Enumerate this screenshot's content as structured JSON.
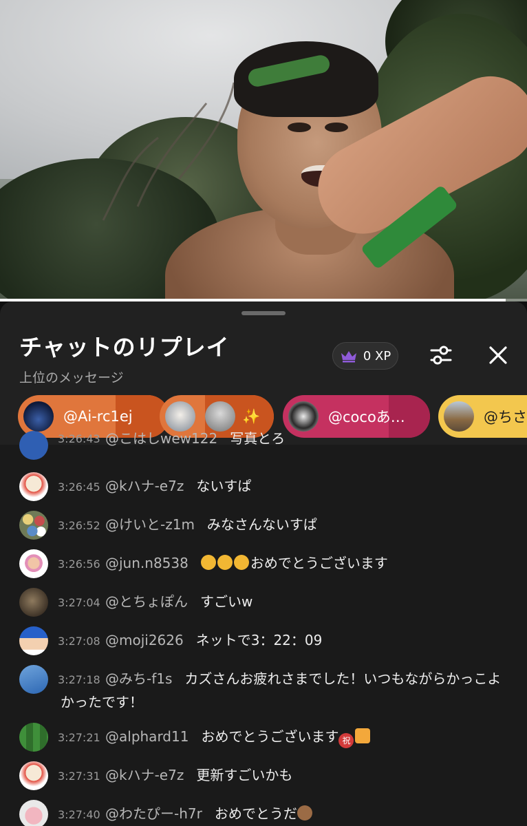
{
  "player": {
    "progress_fraction": 0.96
  },
  "panel": {
    "title": "チャットのリプレイ",
    "subtitle": "上位のメッセージ",
    "xp_label": "0 XP",
    "icons": {
      "xp": "crown-icon",
      "filter": "sliders-icon",
      "close": "close-icon"
    }
  },
  "chips": [
    {
      "label": "@Ai-rc1ej",
      "color": "#e0763c"
    },
    {
      "label": "✨",
      "color": "#e0763c"
    },
    {
      "label": "@cocoあ…",
      "color": "#c53160"
    },
    {
      "label": "@ちさ",
      "color": "#f3c74e"
    }
  ],
  "messages": [
    {
      "time": "3:26:43",
      "author": "@こはしwew122",
      "text": "写真とろ"
    },
    {
      "time": "3:26:45",
      "author": "@kハナ-e7z",
      "text": "ないすぱ"
    },
    {
      "time": "3:26:52",
      "author": "@けいと-z1m",
      "text": "みなさんないすぱ"
    },
    {
      "time": "3:26:56",
      "author": "@jun.n8538",
      "text": "おめでとうございます"
    },
    {
      "time": "3:27:04",
      "author": "@とちょぽん",
      "text": "すごいw"
    },
    {
      "time": "3:27:08",
      "author": "@moji2626",
      "text": "ネットで3：22：09"
    },
    {
      "time": "3:27:18",
      "author": "@みち-f1s",
      "text": "カズさんお疲れさまでした！いつもながらかっこよかったです！"
    },
    {
      "time": "3:27:21",
      "author": "@alphard11",
      "text": "おめでとうございます"
    },
    {
      "time": "3:27:31",
      "author": "@kハナ-e7z",
      "text": "更新すごいかも"
    },
    {
      "time": "3:27:40",
      "author": "@わたぴー-h7r",
      "text": "おめでとうだ"
    }
  ],
  "emoji": {
    "iwai": "祝"
  }
}
